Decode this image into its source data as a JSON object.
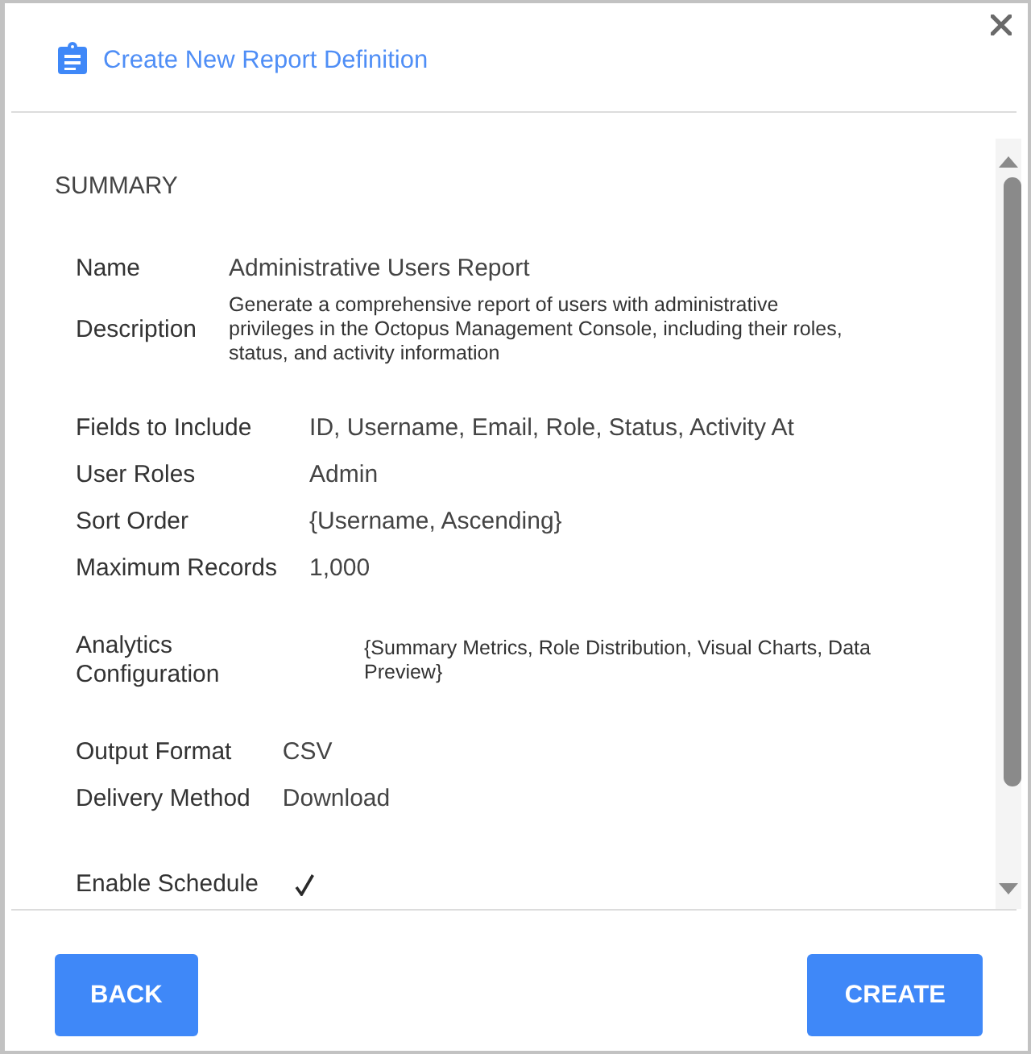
{
  "dialog": {
    "title": "Create New Report Definition"
  },
  "summary": {
    "heading": "SUMMARY",
    "groups": [
      {
        "fields": [
          {
            "kind": "text",
            "label": "Name",
            "value": "Administrative Users Report"
          },
          {
            "kind": "paragraph",
            "label": "Description",
            "value": "Generate a comprehensive report of users with administrative privileges in the Octopus Management Console, including their roles, status, and activity information"
          }
        ]
      },
      {
        "fields": [
          {
            "kind": "text",
            "label": "Fields to Include",
            "value": "ID, Username, Email, Role, Status, Activity At"
          },
          {
            "kind": "text",
            "label": "User Roles",
            "value": "Admin"
          },
          {
            "kind": "text",
            "label": "Sort Order",
            "value": "{Username, Ascending}"
          },
          {
            "kind": "text",
            "label": "Maximum Records",
            "value": "1,000"
          }
        ]
      },
      {
        "fields": [
          {
            "kind": "paragraph",
            "label": "Analytics Configuration",
            "value": "{Summary Metrics, Role Distribution, Visual Charts, Data Preview}"
          }
        ]
      },
      {
        "fields": [
          {
            "kind": "text",
            "label": "Output Format",
            "value": "CSV"
          },
          {
            "kind": "text",
            "label": "Delivery Method",
            "value": "Download"
          }
        ]
      },
      {
        "fields": [
          {
            "kind": "check",
            "label": "Enable Schedule",
            "checked": true
          }
        ]
      }
    ]
  },
  "buttons": [
    {
      "label": "BACK"
    },
    {
      "label": "CREATE"
    }
  ]
}
